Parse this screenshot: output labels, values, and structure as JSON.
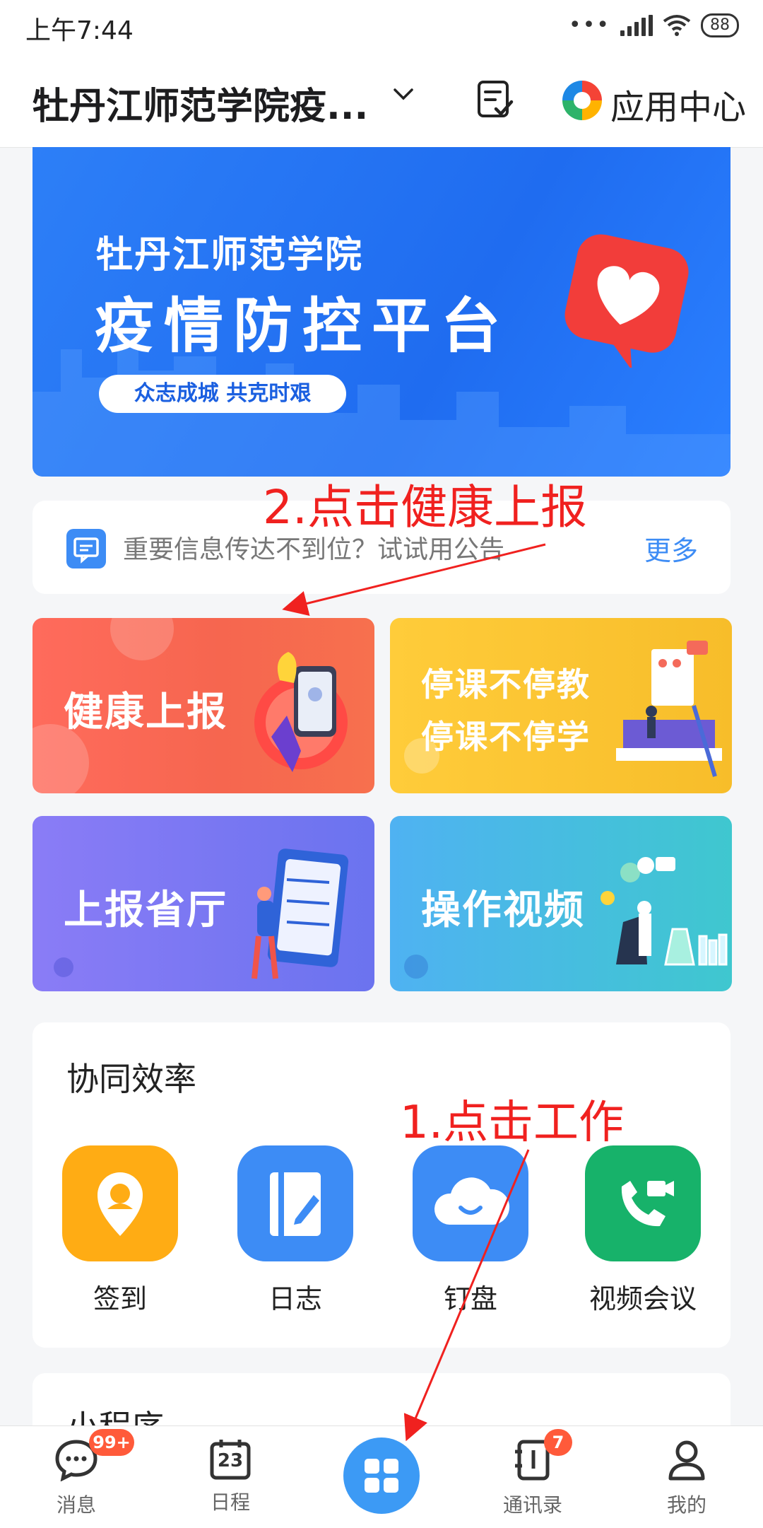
{
  "status_bar": {
    "time": "上午7:44",
    "battery": "88"
  },
  "header": {
    "title": "牡丹江师范学院疫...",
    "app_center_label": "应用中心"
  },
  "banner": {
    "subtitle": "牡丹江师范学院",
    "title": "疫情防控平台",
    "slogan": "众志成城 共克时艰"
  },
  "notice": {
    "text": "重要信息传达不到位？试试用公告",
    "more_label": "更多"
  },
  "cards": [
    {
      "label": "健康上报"
    },
    {
      "line1": "停课不停教",
      "line2": "停课不停学"
    },
    {
      "label": "上报省厅"
    },
    {
      "label": "操作视频"
    }
  ],
  "collab": {
    "heading": "协同效率",
    "items": [
      {
        "label": "签到",
        "color": "#ffac14",
        "icon": "location-pin-icon"
      },
      {
        "label": "日志",
        "color": "#3d8cf5",
        "icon": "notebook-icon"
      },
      {
        "label": "钉盘",
        "color": "#3d8cf5",
        "icon": "cloud-icon"
      },
      {
        "label": "视频会议",
        "color": "#17b26a",
        "icon": "video-call-icon"
      }
    ]
  },
  "mini_program": {
    "heading": "小程序"
  },
  "tabbar": {
    "messages": {
      "label": "消息",
      "badge": "99+"
    },
    "calendar": {
      "label": "日程",
      "date": "23"
    },
    "work": {
      "label": ""
    },
    "contacts": {
      "label": "通讯录",
      "badge": "7"
    },
    "me": {
      "label": "我的"
    }
  },
  "annotations": {
    "step2": "2.点击健康上报",
    "step1": "1.点击工作"
  },
  "colors": {
    "accent": "#3d8cf5",
    "annotation": "#f0211f"
  }
}
